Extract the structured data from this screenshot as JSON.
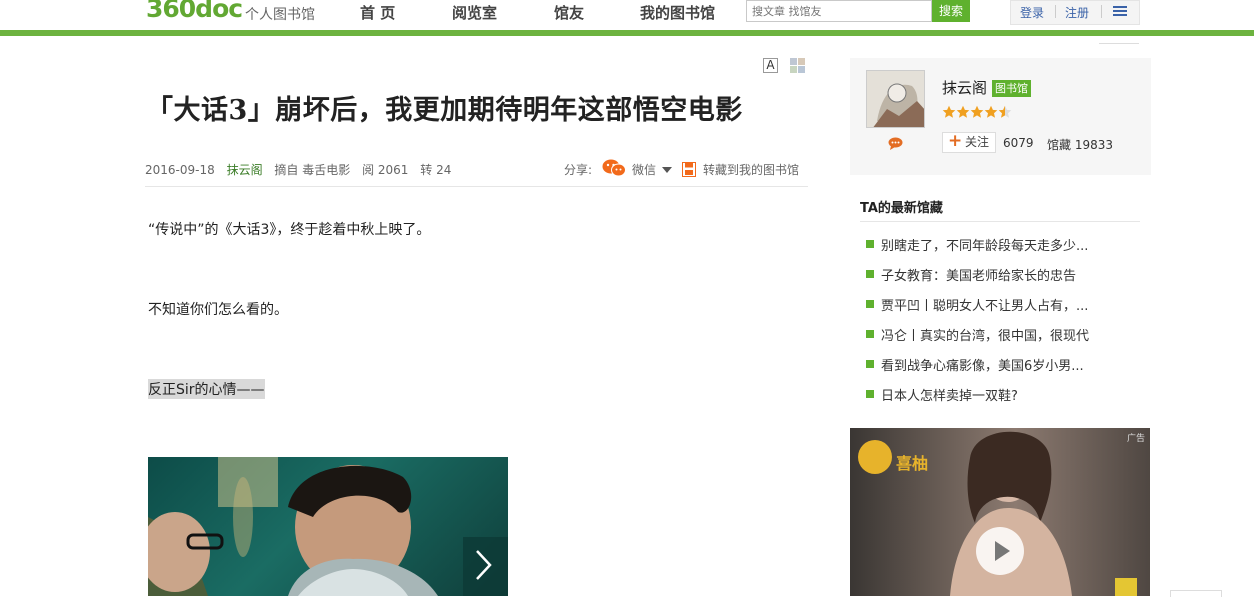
{
  "header": {
    "logo": "360doc",
    "logo_sub": "个人图书馆",
    "nav": [
      "首 页",
      "阅览室",
      "馆友",
      "我的图书馆"
    ],
    "search_placeholder": "搜文章 找馆友",
    "search_button": "搜索",
    "login": "登录",
    "register": "注册",
    "menu_icon": "list-icon",
    "brand_color": "#6db33f"
  },
  "article": {
    "font_tool": "A",
    "title": "「大话3」崩坏后，我更加期待明年这部悟空电影",
    "meta": {
      "date": "2016-09-18",
      "author": "抹云阁",
      "source": "摘自 毒舌电影",
      "reads": "阅 2061",
      "reposts": "转 24"
    },
    "share": {
      "label": "分享:",
      "wechat": "微信",
      "save": "转藏到我的图书馆"
    },
    "paragraphs": [
      "“传说中”的《大话3》，终于趁着中秋上映了。",
      "不知道你们怎么看的。",
      "反正Sir的心情——"
    ]
  },
  "sidebar": {
    "profile": {
      "name": "抹云阁",
      "badge": "图书馆",
      "rating": 4.5,
      "follow": "关注",
      "followers": "6079",
      "collection": "馆藏 19833"
    },
    "latest": {
      "title": "TA的最新馆藏",
      "items": [
        "别瞎走了，不同年龄段每天走多少...",
        "子女教育：美国老师给家长的忠告",
        "贾平凹丨聪明女人不让男人占有，...",
        "冯仑丨真实的台湾，很中国，很现代",
        "看到战争心痛影像，美国6岁小男...",
        "日本人怎样卖掉一双鞋?"
      ]
    },
    "ad": {
      "tag": "广告",
      "brand": "喜柚"
    }
  }
}
